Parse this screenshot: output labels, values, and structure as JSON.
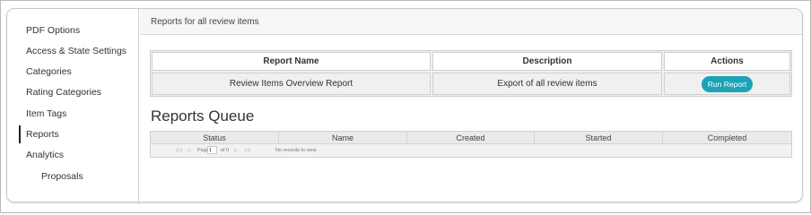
{
  "sidebar": {
    "items": [
      {
        "label": "PDF Options"
      },
      {
        "label": "Access & State Settings"
      },
      {
        "label": "Categories"
      },
      {
        "label": "Rating Categories"
      },
      {
        "label": "Item Tags"
      },
      {
        "label": "Reports"
      },
      {
        "label": "Analytics"
      },
      {
        "label": "Proposals"
      }
    ],
    "active": "Reports"
  },
  "main": {
    "header": "Reports for all review items",
    "report_table": {
      "columns": [
        "Report Name",
        "Description",
        "Actions"
      ],
      "rows": [
        {
          "name": "Review Items Overview Report",
          "description": "Export of all review items",
          "action_label": "Run Report"
        }
      ]
    },
    "queue": {
      "title": "Reports Queue",
      "columns": [
        "Status",
        "Name",
        "Created",
        "Started",
        "Completed"
      ],
      "pager": {
        "first": "|◁",
        "prev": "◁",
        "page_label": "Page",
        "page_value": "1",
        "of_label": "of 0",
        "next": "▷",
        "last": "▷|"
      },
      "empty_message": "No records to view"
    },
    "accent_color": "#1aa3b7"
  }
}
